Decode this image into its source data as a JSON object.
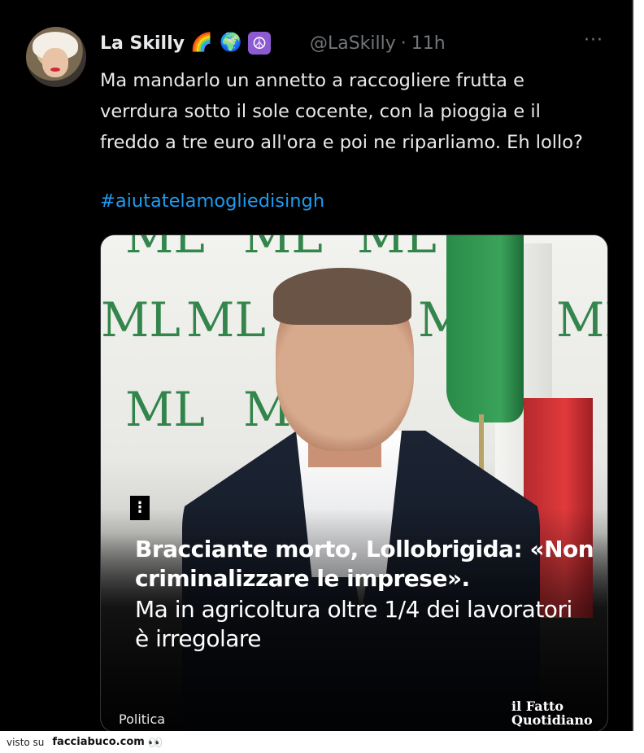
{
  "tweet": {
    "author": {
      "display_name": "La Skilly",
      "emojis": [
        "🌈",
        "🌍",
        "☮",
        "🕊"
      ],
      "handle": "@LaSkilly",
      "separator": "·",
      "time": "11h"
    },
    "more_icon": "···",
    "text": "Ma mandarlo un annetto a raccogliere frutta e verrdura sotto il sole cocente, con la pioggia e il freddo a tre euro all'ora e poi ne riparliamo. Eh lollo?",
    "hashtag": "#aiutatelamogliedisingh",
    "media": {
      "menu_glyph": "⋮",
      "headline": "Bracciante morto, Lollobrigida: «Non criminalizzare le imprese».",
      "subheadline": "Ma in agricoltura oltre 1/4 dei lavoratori è irregolare",
      "category": "Politica",
      "brand": "il Fatto Quotidiano",
      "backdrop_logo": "ML",
      "backdrop_logo_red": "L"
    }
  },
  "footer": {
    "prefix": "visto su",
    "site": "facciabuco.com",
    "icon": "👀"
  },
  "colors": {
    "background": "#000000",
    "text": "#e7e9ea",
    "muted": "#71767b",
    "link": "#1d9bf0"
  }
}
